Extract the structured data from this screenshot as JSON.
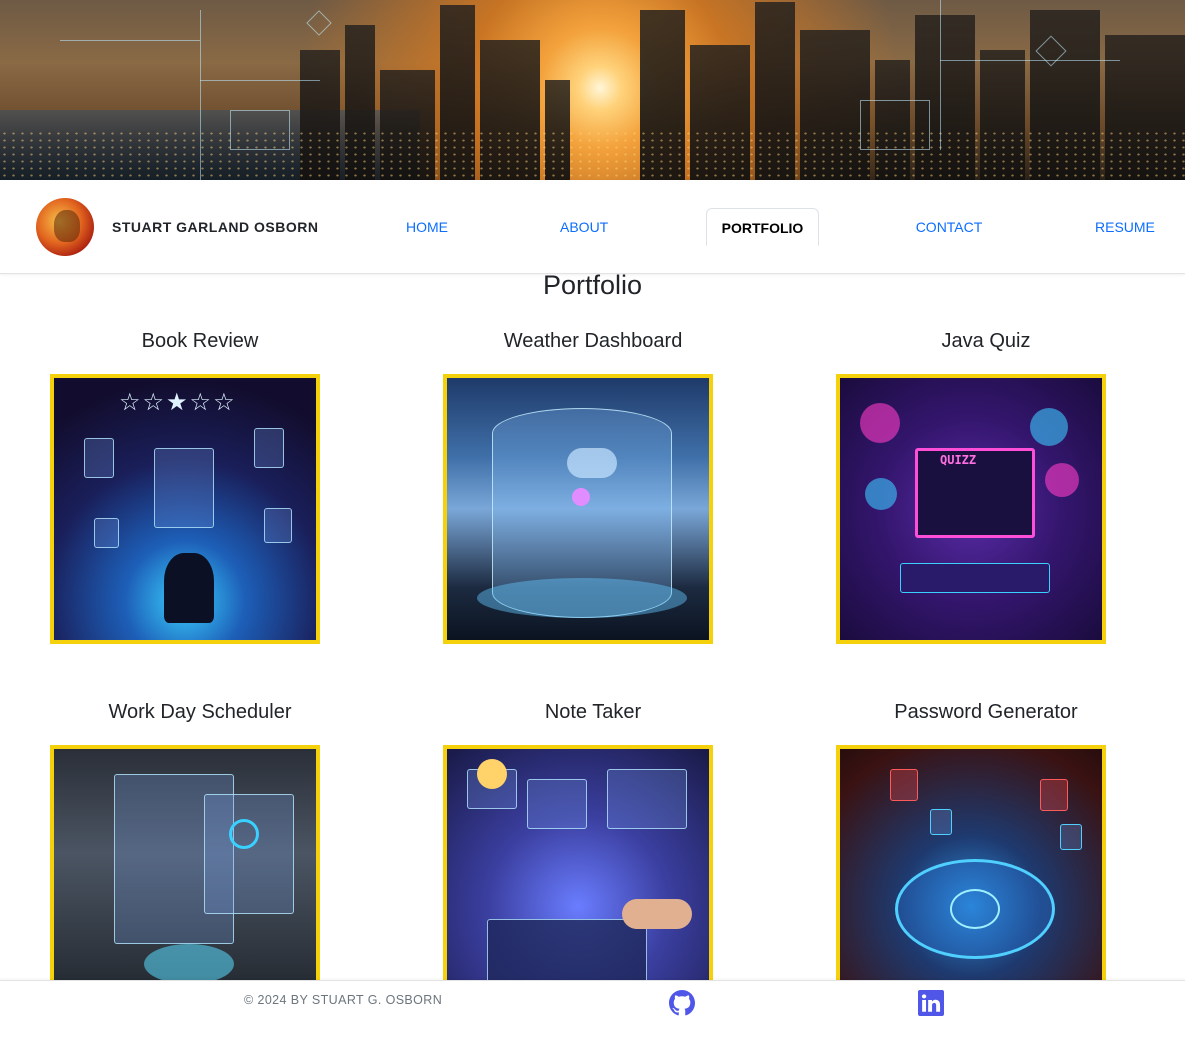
{
  "header": {
    "name": "STUART GARLAND OSBORN",
    "avatar_icon": "profile-photo"
  },
  "nav": {
    "items": [
      {
        "label": "HOME",
        "active": false
      },
      {
        "label": "ABOUT",
        "active": false
      },
      {
        "label": "PORTFOLIO",
        "active": true
      },
      {
        "label": "CONTACT",
        "active": false
      },
      {
        "label": "RESUME",
        "active": false
      }
    ]
  },
  "portfolio": {
    "title": "Portfolio",
    "projects": [
      {
        "title": "Book Review"
      },
      {
        "title": "Weather Dashboard"
      },
      {
        "title": "Java Quiz"
      },
      {
        "title": "Work Day Scheduler"
      },
      {
        "title": "Note Taker"
      },
      {
        "title": "Password Generator"
      }
    ]
  },
  "footer": {
    "copyright": "© 2024 BY STUART G. OSBORN",
    "links": [
      {
        "icon": "github-icon"
      },
      {
        "icon": "linkedin-icon"
      }
    ]
  },
  "colors": {
    "accent_link": "#0d6efd",
    "card_border": "#f5d10c",
    "linkedin": "#4f56e8",
    "github": "#4f56e8"
  }
}
